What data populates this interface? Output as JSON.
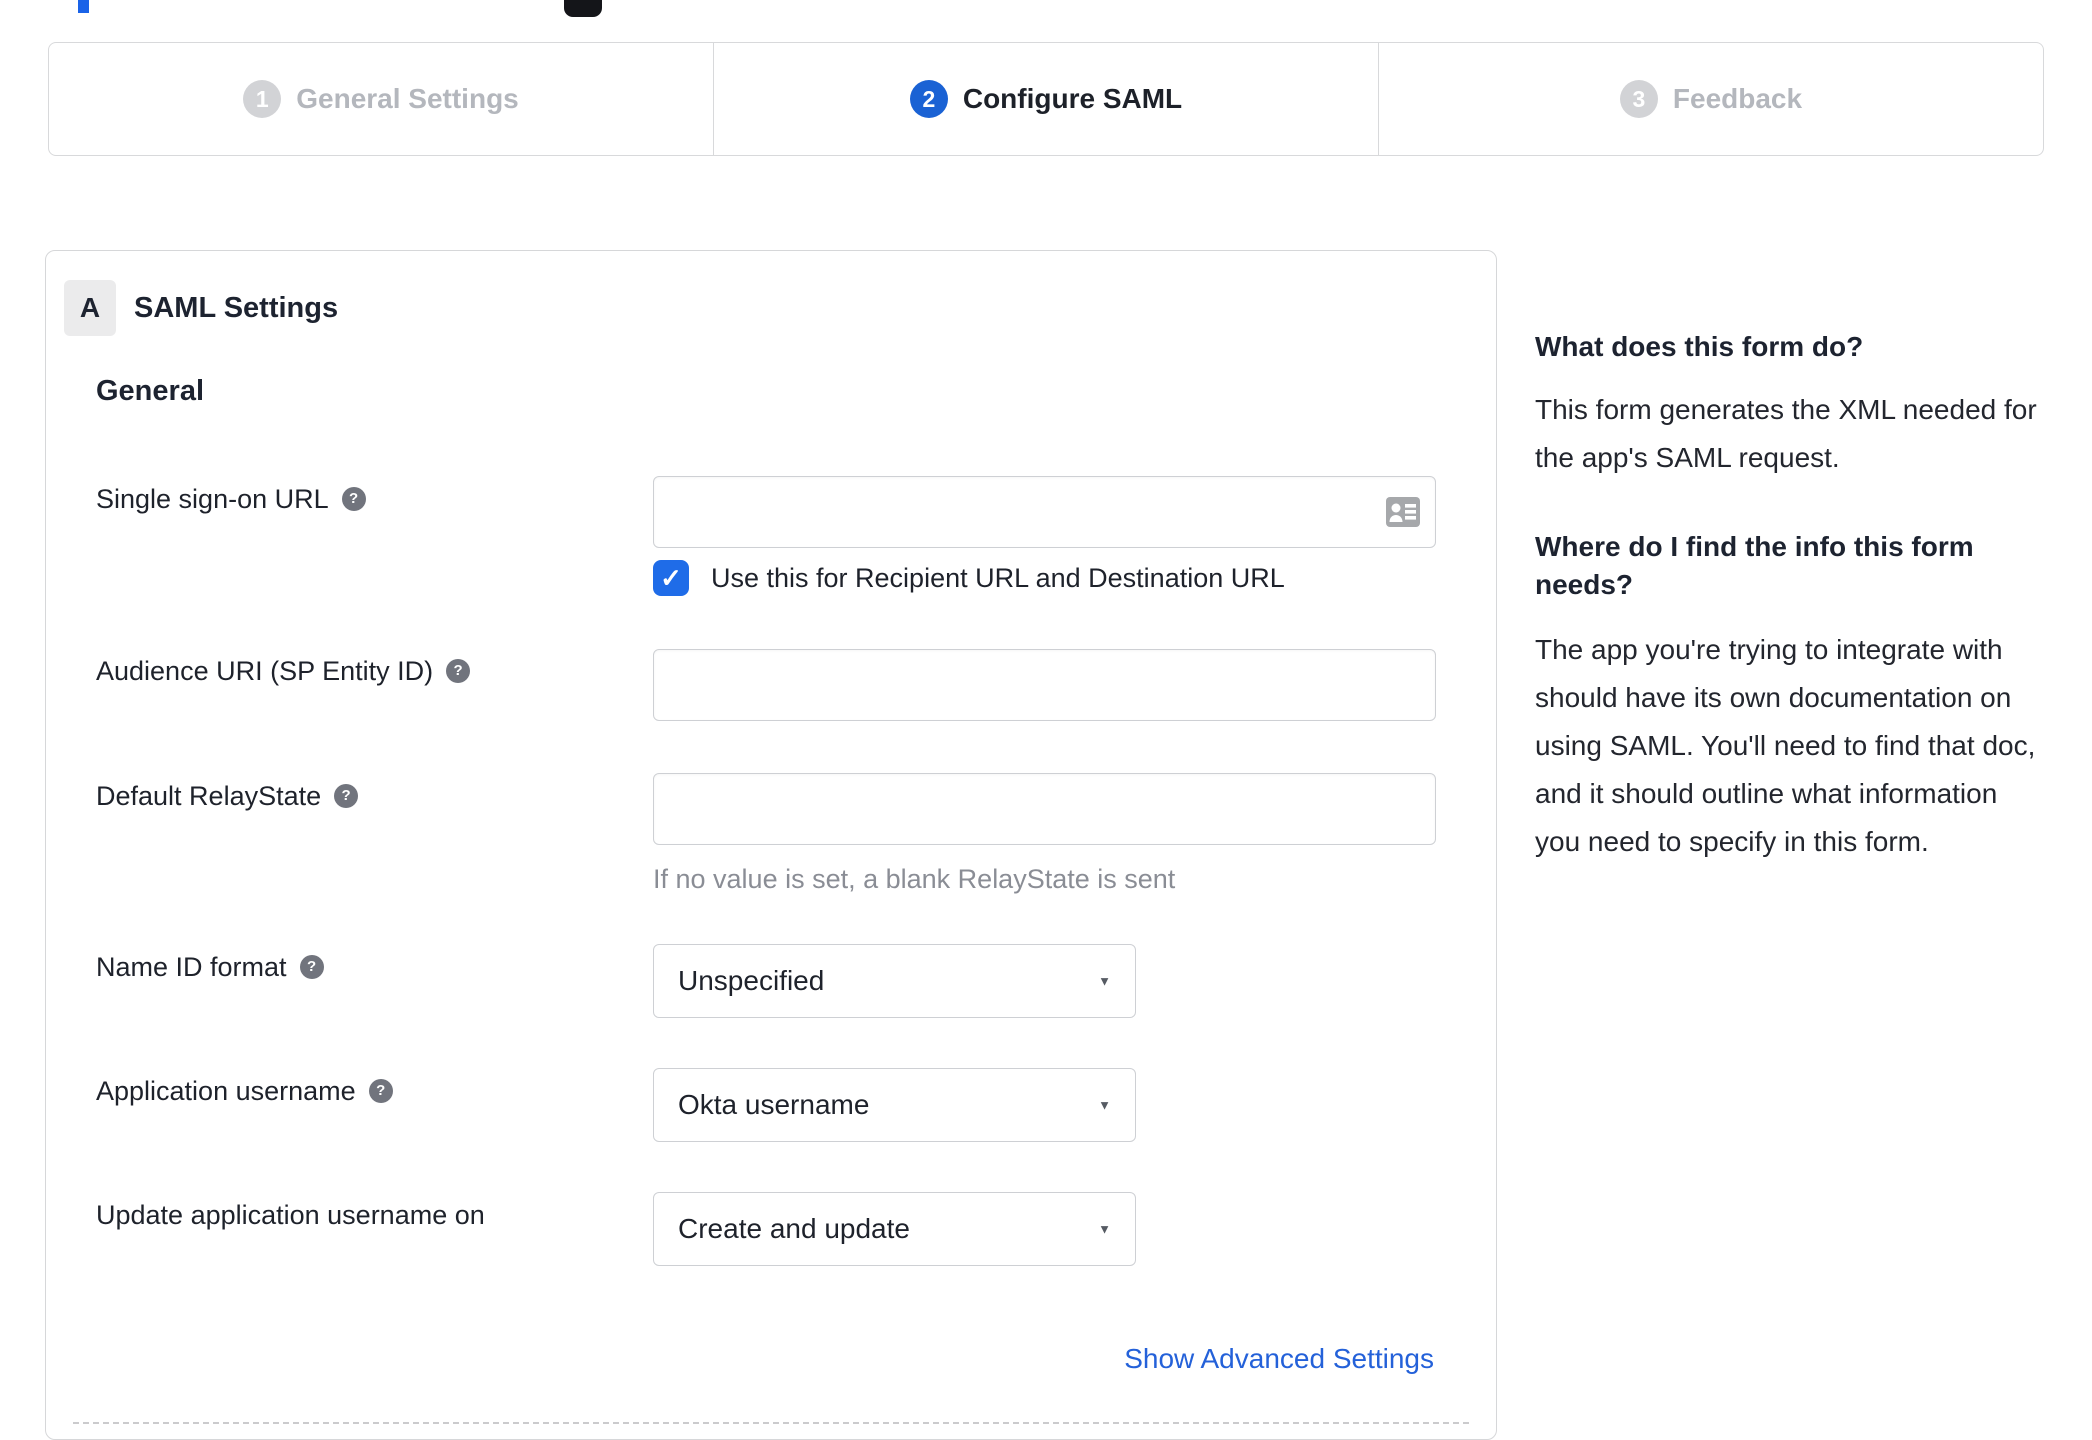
{
  "colors": {
    "active_blue": "#1a62d4",
    "checkbox_blue": "#1f6ce8",
    "link_blue": "#2461d9"
  },
  "icons": {
    "help_glyph": "?",
    "caret_glyph": "▼",
    "check_glyph": "✓"
  },
  "stepper": {
    "steps": [
      {
        "number": "1",
        "label": "General Settings",
        "state": "inactive"
      },
      {
        "number": "2",
        "label": "Configure SAML",
        "state": "active"
      },
      {
        "number": "3",
        "label": "Feedback",
        "state": "inactive"
      }
    ]
  },
  "panel": {
    "badge": "A",
    "title": "SAML Settings",
    "section_heading": "General"
  },
  "form": {
    "sso": {
      "label": "Single sign-on URL",
      "value": "",
      "has_help": true,
      "checkbox_label": "Use this for Recipient URL and Destination URL",
      "checkbox_checked": true
    },
    "audience": {
      "label": "Audience URI (SP Entity ID)",
      "value": "",
      "has_help": true
    },
    "relay": {
      "label": "Default RelayState",
      "value": "",
      "has_help": true,
      "hint": "If no value is set, a blank RelayState is sent"
    },
    "name_id": {
      "label": "Name ID format",
      "value": "Unspecified",
      "has_help": true
    },
    "app_username": {
      "label": "Application username",
      "value": "Okta username",
      "has_help": true
    },
    "update_username": {
      "label": "Update application username on",
      "value": "Create and update",
      "has_help": false
    },
    "advanced_link": "Show Advanced Settings"
  },
  "sidebar": {
    "q1": {
      "heading": "What does this form do?",
      "body": "This form generates the XML needed for the app's SAML request."
    },
    "q2": {
      "heading": "Where do I find the info this form needs?",
      "body": "The app you're trying to integrate with should have its own documentation on using SAML. You'll need to find that doc, and it should outline what information you need to specify in this form."
    }
  }
}
